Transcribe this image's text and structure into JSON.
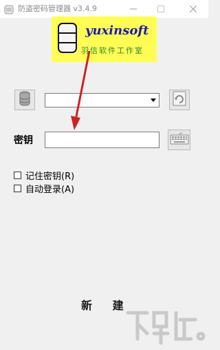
{
  "window": {
    "title": "防盗密码管理器 v3.4.9"
  },
  "logo": {
    "brand": "yuxinsoft",
    "subtitle": "羽信软件工作室"
  },
  "toolbar": {
    "db_icon": "database-icon",
    "refresh_icon": "refresh-icon",
    "keyboard_icon": "keyboard-icon"
  },
  "account_select": {
    "value": ""
  },
  "key": {
    "label": "密钥",
    "value": ""
  },
  "options": {
    "remember_key": {
      "label": "记住密钥(R)",
      "checked": false
    },
    "auto_login": {
      "label": "自动登录(A)",
      "checked": false
    }
  },
  "actions": {
    "new_label": "新 建"
  },
  "colors": {
    "logo_bg": "#fffd54",
    "brand_text": "#1b1bb0",
    "subtitle_text": "#2d8a2d",
    "annotation_arrow": "#d02020"
  }
}
